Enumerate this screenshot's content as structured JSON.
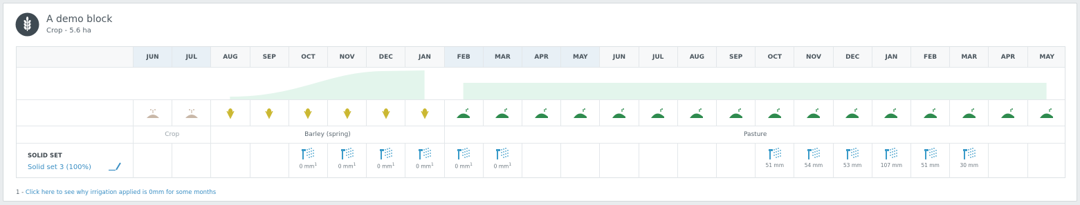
{
  "block": {
    "title": "A demo block",
    "subtitle": "Crop - 5.6 ha",
    "icon": "wheat-icon"
  },
  "months": [
    "JUN",
    "JUL",
    "AUG",
    "SEP",
    "OCT",
    "NOV",
    "DEC",
    "JAN",
    "FEB",
    "MAR",
    "APR",
    "MAY",
    "JUN",
    "JUL",
    "AUG",
    "SEP",
    "OCT",
    "NOV",
    "DEC",
    "JAN",
    "FEB",
    "MAR",
    "APR",
    "MAY"
  ],
  "shaded_month_indices": [
    0,
    1,
    8,
    9,
    10,
    11
  ],
  "growth_icons": [
    "sprout-icon",
    "sprout-icon",
    "grain-icon",
    "grain-icon",
    "grain-icon",
    "grain-icon",
    "grain-icon",
    "grain-icon",
    "pasture-icon",
    "pasture-icon",
    "pasture-icon",
    "pasture-icon",
    "pasture-icon",
    "pasture-icon",
    "pasture-icon",
    "pasture-icon",
    "pasture-icon",
    "pasture-icon",
    "pasture-icon",
    "pasture-icon",
    "pasture-icon",
    "pasture-icon",
    "pasture-icon",
    "pasture-icon"
  ],
  "crops": [
    {
      "label": "Crop",
      "muted": true
    },
    {
      "label": "Barley (spring)",
      "muted": false
    },
    {
      "label": "Pasture",
      "muted": false
    }
  ],
  "solid_set": {
    "title": "SOLID SET",
    "link": "Solid set 3 (100%)",
    "edit_icon": "pencil-icon"
  },
  "irrigation": [
    "",
    "",
    "",
    "",
    "0 mm",
    "0 mm",
    "0 mm",
    "0 mm",
    "0 mm",
    "0 mm",
    "",
    "",
    "",
    "",
    "",
    "",
    "51 mm",
    "54 mm",
    "53 mm",
    "107 mm",
    "51 mm",
    "30 mm",
    "",
    ""
  ],
  "irrigation_footnote_indices": [
    4,
    5,
    6,
    7,
    8,
    9
  ],
  "footnote_mark": "1",
  "note": {
    "prefix": "1 - ",
    "link": "Click here to see why irrigation applied is 0mm for some months"
  },
  "colors": {
    "growth_fill": "#e3f5ec",
    "grain": "#cbb832",
    "pasture": "#2e8b4e",
    "sprout": "#c9b8a8",
    "sprinkler": "#3a9bc9",
    "link": "#3b8fc4"
  }
}
